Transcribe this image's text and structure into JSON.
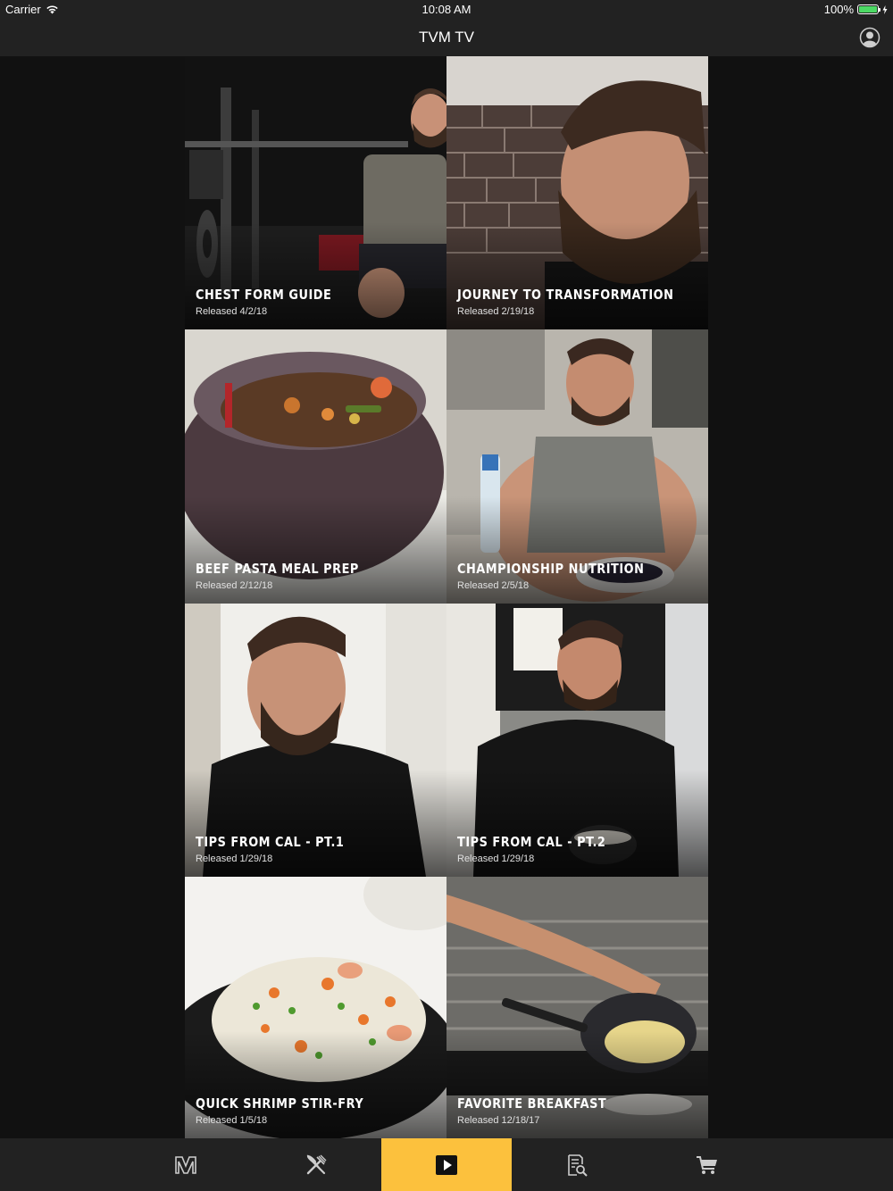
{
  "status_bar": {
    "carrier": "Carrier",
    "time": "10:08 AM",
    "battery": "100%"
  },
  "nav": {
    "title": "TVM TV",
    "profile_icon": "profile-icon"
  },
  "videos": [
    {
      "title": "CHEST FORM GUIDE",
      "date": "Released 4/2/18"
    },
    {
      "title": "JOURNEY TO TRANSFORMATION",
      "date": "Released 2/19/18"
    },
    {
      "title": "BEEF PASTA MEAL PREP",
      "date": "Released 2/12/18"
    },
    {
      "title": "CHAMPIONSHIP NUTRITION",
      "date": "Released 2/5/18"
    },
    {
      "title": "TIPS FROM CAL - PT.1",
      "date": "Released 1/29/18"
    },
    {
      "title": "TIPS FROM CAL - PT.2",
      "date": "Released 1/29/18"
    },
    {
      "title": "QUICK SHRIMP STIR-FRY",
      "date": "Released 1/5/18"
    },
    {
      "title": "FAVORITE BREAKFAST",
      "date": "Released 12/18/17"
    }
  ],
  "tabs": [
    {
      "icon": "tvm-logo-icon"
    },
    {
      "icon": "fork-knife-icon"
    },
    {
      "icon": "play-icon",
      "active": true
    },
    {
      "icon": "document-search-icon"
    },
    {
      "icon": "cart-icon"
    }
  ],
  "colors": {
    "background": "#111111",
    "bar": "#222222",
    "accent": "#fcc13d",
    "battery": "#4cd964"
  }
}
